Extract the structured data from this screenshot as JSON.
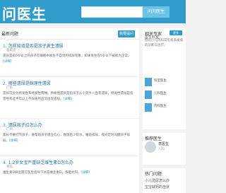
{
  "header": {
    "logo_text": "问医生",
    "search_button": "问问医生"
  },
  "main": {
    "title": "最新问题",
    "ask_button": "我要提问",
    "questions": [
      {
        "num": "1.",
        "title": "怎样知道是否是孩子发生遗尿",
        "meta": "石家庄",
        "body": "遗尿是指5岁以上的孩子在睡眠中发生不自觉的排尿现象，如果发生在5岁以下被视为正常。",
        "more": "[详细]"
      },
      {
        "num": "2.",
        "title": "哪些遗尿是病理性遗尿",
        "meta": "广东",
        "body": "遗尿可分为原发性和继发性两种。原发性遗尿是指孩子从小到大一直有遗尿，继发性遗尿是指曾经有过半年以上不尿床然后又出现遗尿。",
        "more": "[详细]"
      },
      {
        "num": "3.",
        "title": "遗尿孩子应怎么办",
        "meta": "广州",
        "body": "家长不要打骂孩子，要帮助孩子建立信心，晚饭后少饮水，睡前排尿，夜间定时叫醒孩子排尿。",
        "more": "[详细]"
      },
      {
        "num": "4.",
        "title": "1.2岁女宝严重缺乏维生素D怎么办",
        "meta": "青岛",
        "body": "维生素D缺乏需在医生指导下补充维生素D，多晒太阳，",
        "more": "[详细]"
      }
    ]
  },
  "sidebar": {
    "box1": {
      "title": "相关专家",
      "button": "更多",
      "line1": "医生科室",
      "desc": "擅长小儿内科常见病多发病的诊断与治疗。",
      "docs": [
        "科室医生",
        "儿科医生",
        "内科医生"
      ]
    },
    "box2": {
      "title": "推荐医生",
      "doctor_name": "李医生",
      "doctor_dept": "儿科"
    },
    "box3": {
      "title": "热门问题",
      "line1": "小儿遗尿怎么办",
      "line2": "宝宝缺钙的症状"
    }
  }
}
